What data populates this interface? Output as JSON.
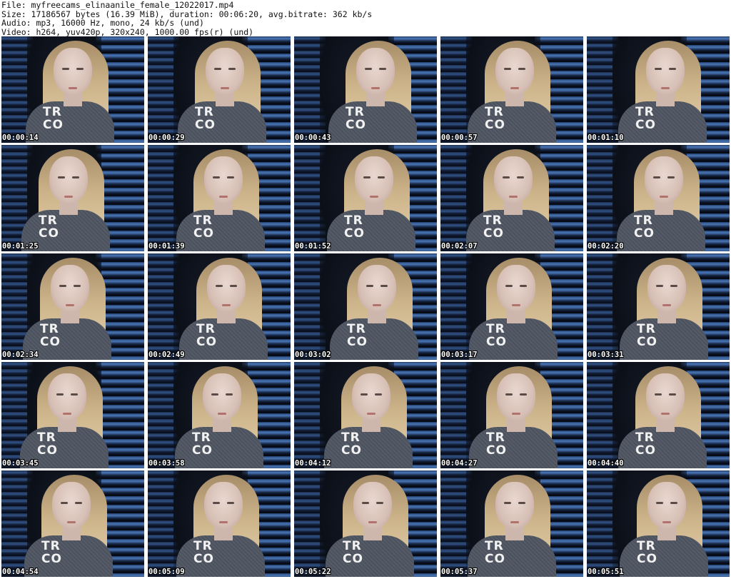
{
  "header": {
    "file_line": "File: myfreecams_elinaanile_female_12022017.mp4",
    "size_line": "Size: 17186567 bytes (16.39 MiB), duration: 00:06:20, avg.bitrate: 362 kb/s",
    "audio_line": "Audio: mp3, 16000 Hz, mono, 24 kb/s (und)",
    "video_line": "Video: h264, yuv420p, 320x240, 1000.00 fps(r) (und)"
  },
  "frames": [
    {
      "time": "00:00:14",
      "shirt_text": "TR CO"
    },
    {
      "time": "00:00:29",
      "shirt_text": "TR CO"
    },
    {
      "time": "00:00:43",
      "shirt_text": "TR CO"
    },
    {
      "time": "00:00:57",
      "shirt_text": "TR CO"
    },
    {
      "time": "00:01:10",
      "shirt_text": "TR CO"
    },
    {
      "time": "00:01:25",
      "shirt_text": "TR CO"
    },
    {
      "time": "00:01:39",
      "shirt_text": "TR CO"
    },
    {
      "time": "00:01:52",
      "shirt_text": "TR CO"
    },
    {
      "time": "00:02:07",
      "shirt_text": "TR CO"
    },
    {
      "time": "00:02:20",
      "shirt_text": "TR CO"
    },
    {
      "time": "00:02:34",
      "shirt_text": "TR CO"
    },
    {
      "time": "00:02:49",
      "shirt_text": "TR CO"
    },
    {
      "time": "00:03:02",
      "shirt_text": "TR CO"
    },
    {
      "time": "00:03:17",
      "shirt_text": "TR CO"
    },
    {
      "time": "00:03:31",
      "shirt_text": "TR CO"
    },
    {
      "time": "00:03:45",
      "shirt_text": "TR CO"
    },
    {
      "time": "00:03:58",
      "shirt_text": "TR CO"
    },
    {
      "time": "00:04:12",
      "shirt_text": "TR CO"
    },
    {
      "time": "00:04:27",
      "shirt_text": "TR CO"
    },
    {
      "time": "00:04:40",
      "shirt_text": "TR CO"
    },
    {
      "time": "00:04:54",
      "shirt_text": "TR CO"
    },
    {
      "time": "00:05:09",
      "shirt_text": "TR CO"
    },
    {
      "time": "00:05:22",
      "shirt_text": "TR CO"
    },
    {
      "time": "00:05:37",
      "shirt_text": "TR CO"
    },
    {
      "time": "00:05:51",
      "shirt_text": "TR CO"
    }
  ],
  "colors": {
    "background": "#ffffff",
    "header_text": "#111111",
    "timestamp_text": "#ffffff",
    "blinds_highlight": "#3d6aa8",
    "shirt": "#4e5561",
    "hair": "#cdb48a"
  }
}
